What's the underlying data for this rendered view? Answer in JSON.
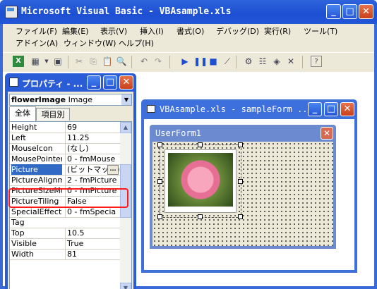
{
  "app": {
    "title": "Microsoft Visual Basic - VBAsample.xls",
    "controls": {
      "minimize": "_",
      "maximize": "□",
      "close": "✕"
    }
  },
  "menu": {
    "row1": [
      "ファイル(F)",
      "編集(E)",
      "表示(V)",
      "挿入(I)",
      "書式(O)",
      "デバッグ(D)",
      "実行(R)",
      "ツール(T)"
    ],
    "row2": [
      "アドイン(A)",
      "ウィンドウ(W)",
      "ヘルプ(H)"
    ]
  },
  "properties_window": {
    "title": "プロパティ - ...",
    "object_name": "flowerImage",
    "object_type": "Image",
    "tabs": [
      "全体",
      "項目別"
    ],
    "rows": [
      {
        "name": "Height",
        "value": "69"
      },
      {
        "name": "Left",
        "value": "11.25"
      },
      {
        "name": "MouseIcon",
        "value": "(なし)"
      },
      {
        "name": "MousePointer",
        "value": "0 - fmMouse"
      },
      {
        "name": "Picture",
        "value": "(ビットマップ)"
      },
      {
        "name": "PictureAlignment",
        "value": "2 - fmPicture"
      },
      {
        "name": "PictureSizeMode",
        "value": "0 - fmPicture"
      },
      {
        "name": "PictureTiling",
        "value": "False"
      },
      {
        "name": "SpecialEffect",
        "value": "0 - fmSpecia"
      },
      {
        "name": "Tag",
        "value": ""
      },
      {
        "name": "Top",
        "value": "10.5"
      },
      {
        "name": "Visible",
        "value": "True"
      },
      {
        "name": "Width",
        "value": "81"
      }
    ],
    "selected_property": "Picture"
  },
  "form_window": {
    "title": "VBAsample.xls - sampleForm ...",
    "userform_title": "UserForm1"
  }
}
